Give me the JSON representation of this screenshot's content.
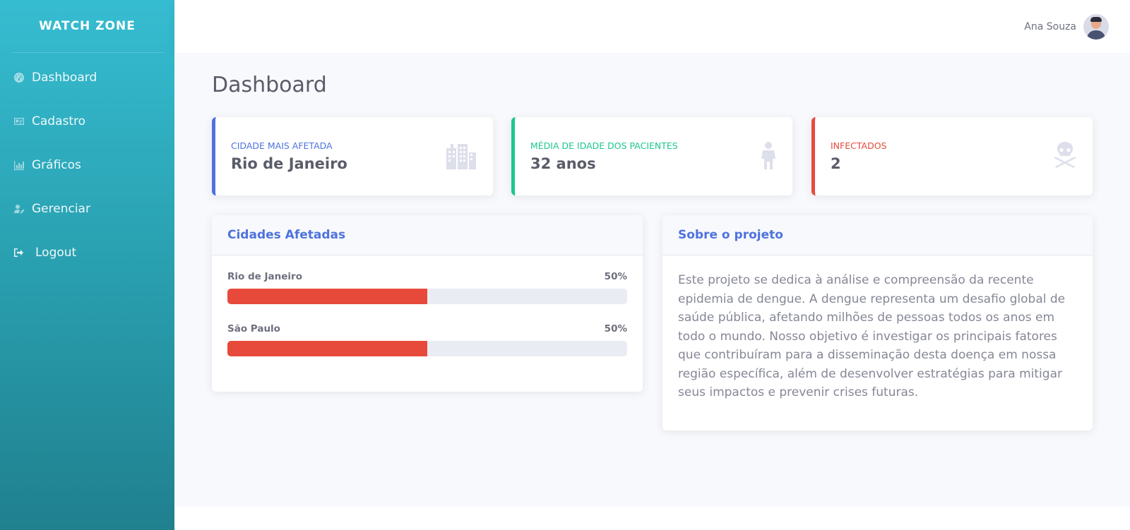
{
  "sidebar": {
    "brand": "WATCH ZONE",
    "items": [
      {
        "label": "Dashboard",
        "icon": "dashboard-icon"
      },
      {
        "label": "Cadastro",
        "icon": "id-card-icon"
      },
      {
        "label": "Gráficos",
        "icon": "chart-icon"
      },
      {
        "label": "Gerenciar",
        "icon": "user-edit-icon"
      },
      {
        "label": "Logout",
        "icon": "sign-out-icon"
      }
    ]
  },
  "topbar": {
    "user_name": "Ana Souza",
    "avatar_icon": "avatar-icon"
  },
  "page": {
    "title": "Dashboard"
  },
  "cards": [
    {
      "label": "CIDADE MAIS AFETADA",
      "value": "Rio de Janeiro",
      "icon": "city-icon",
      "color": "#4e73df"
    },
    {
      "label": "MÉDIA DE IDADE DOS PACIENTES",
      "value": "32 anos",
      "icon": "child-icon",
      "color": "#1cc88a"
    },
    {
      "label": "INFECTADOS",
      "value": "2",
      "icon": "skull-crossbones-icon",
      "color": "#e74a3b"
    }
  ],
  "cities_panel": {
    "title": "Cidades Afetadas",
    "rows": [
      {
        "city": "Rio de Janeiro",
        "percent_label": "50%",
        "percent": 50
      },
      {
        "city": "São Paulo",
        "percent_label": "50%",
        "percent": 50
      }
    ],
    "bar_color": "#e74a3b"
  },
  "about_panel": {
    "title": "Sobre o projeto",
    "text": "Este projeto se dedica à análise e compreensão da recente epidemia de dengue. A dengue representa um desafio global de saúde pública, afetando milhões de pessoas todos os anos em todo o mundo. Nosso objetivo é investigar os principais fatores que contribuíram para a disseminação desta doença em nossa região específica, além de desenvolver estratégias para mitigar seus impactos e prevenir crises futuras."
  }
}
